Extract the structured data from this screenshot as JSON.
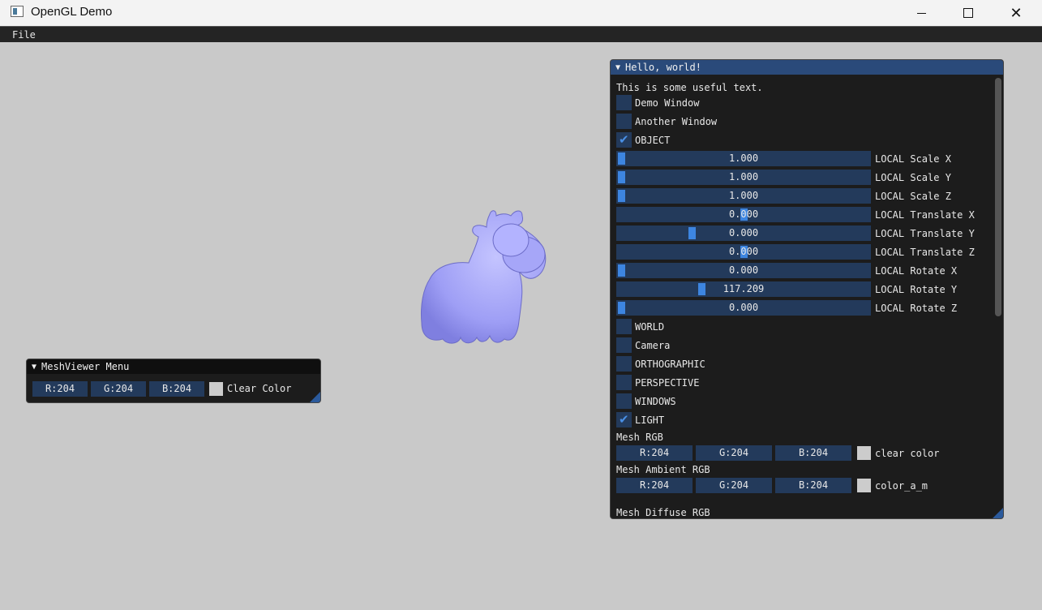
{
  "window": {
    "title": "OpenGL Demo"
  },
  "menubar": {
    "file_label": "File"
  },
  "meshviewer": {
    "header": "MeshViewer Menu",
    "r_label": "R:204",
    "g_label": "G:204",
    "b_label": "B:204",
    "color_label": "Clear Color",
    "color_hex": "#cccccc"
  },
  "hello": {
    "header": "Hello, world!",
    "intro_text": "This is some useful text.",
    "checkboxes": [
      {
        "label": "Demo Window",
        "checked": false
      },
      {
        "label": "Another Window",
        "checked": false
      },
      {
        "label": "OBJECT",
        "checked": true
      }
    ],
    "sliders": [
      {
        "label": "LOCAL Scale X",
        "value": "1.000",
        "fraction": 0.0
      },
      {
        "label": "LOCAL Scale Y",
        "value": "1.000",
        "fraction": 0.0
      },
      {
        "label": "LOCAL Scale Z",
        "value": "1.000",
        "fraction": 0.0
      },
      {
        "label": "LOCAL Translate X",
        "value": "0.000",
        "fraction": 0.5
      },
      {
        "label": "LOCAL Translate Y",
        "value": "0.000",
        "fraction": 0.29
      },
      {
        "label": "LOCAL Translate Z",
        "value": "0.000",
        "fraction": 0.5
      },
      {
        "label": "LOCAL Rotate X",
        "value": "0.000",
        "fraction": 0.0
      },
      {
        "label": "LOCAL Rotate Y",
        "value": "117.209",
        "fraction": 0.33
      },
      {
        "label": "LOCAL Rotate Z",
        "value": "0.000",
        "fraction": 0.0
      }
    ],
    "checkboxes2": [
      {
        "label": "WORLD",
        "checked": false
      },
      {
        "label": "Camera",
        "checked": false
      },
      {
        "label": "ORTHOGRAPHIC",
        "checked": false
      },
      {
        "label": "PERSPECTIVE",
        "checked": false
      },
      {
        "label": "WINDOWS",
        "checked": false
      },
      {
        "label": "LIGHT",
        "checked": true
      }
    ],
    "mesh_rgb": {
      "title": "Mesh RGB",
      "r": "R:204",
      "g": "G:204",
      "b": "B:204",
      "color_label": "clear color"
    },
    "mesh_ambient": {
      "title": "Mesh Ambient RGB",
      "r": "R:204",
      "g": "G:204",
      "b": "B:204",
      "color_label": "color_a_m"
    },
    "mesh_diffuse_title": "Mesh Diffuse RGB"
  },
  "colors": {
    "accent": "#3d85e0",
    "frame": "#233a5b",
    "header_active": "#2a4a7a",
    "model": "#a9a9ff"
  }
}
